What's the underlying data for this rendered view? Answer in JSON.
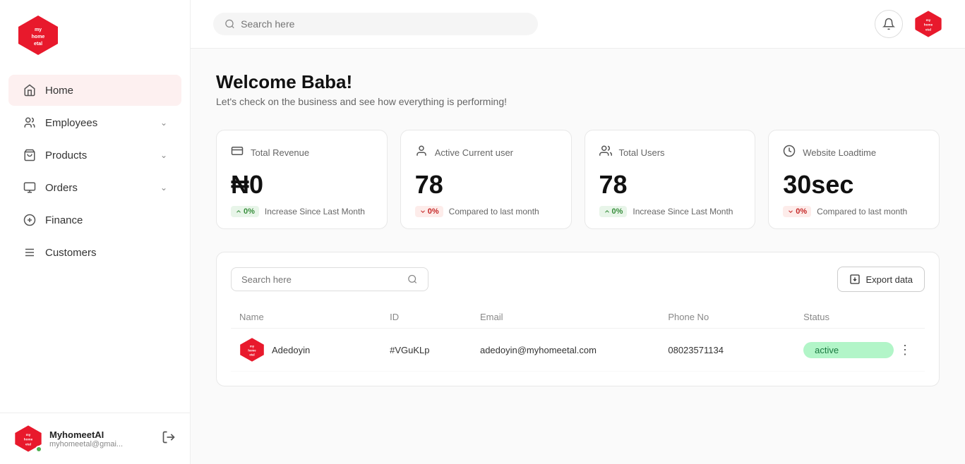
{
  "sidebar": {
    "nav_items": [
      {
        "id": "home",
        "label": "Home",
        "icon": "home",
        "active": true,
        "has_chevron": false
      },
      {
        "id": "employees",
        "label": "Employees",
        "icon": "employees",
        "active": false,
        "has_chevron": true
      },
      {
        "id": "products",
        "label": "Products",
        "icon": "products",
        "active": false,
        "has_chevron": true
      },
      {
        "id": "orders",
        "label": "Orders",
        "icon": "orders",
        "active": false,
        "has_chevron": true
      },
      {
        "id": "finance",
        "label": "Finance",
        "icon": "finance",
        "active": false,
        "has_chevron": false
      },
      {
        "id": "customers",
        "label": "Customers",
        "icon": "customers",
        "active": false,
        "has_chevron": false
      }
    ],
    "user": {
      "name": "MyhomeetAI",
      "email": "myhomeetal@gmai...",
      "status": "online"
    }
  },
  "topbar": {
    "search_placeholder": "Search here"
  },
  "welcome": {
    "title": "Welcome Baba!",
    "subtitle": "Let's check on the business and see how everything is performing!"
  },
  "stat_cards": [
    {
      "id": "total-revenue",
      "icon": "revenue-icon",
      "label": "Total Revenue",
      "value": "₦0",
      "badge_type": "green",
      "badge_value": "0%",
      "badge_text": "Increase Since Last Month"
    },
    {
      "id": "active-users",
      "icon": "user-icon",
      "label": "Active Current user",
      "value": "78",
      "badge_type": "red",
      "badge_value": "0%",
      "badge_text": "Compared to last month"
    },
    {
      "id": "total-users",
      "icon": "users-icon",
      "label": "Total Users",
      "value": "78",
      "badge_type": "green",
      "badge_value": "0%",
      "badge_text": "Increase Since Last Month"
    },
    {
      "id": "website-loadtime",
      "icon": "clock-icon",
      "label": "Website Loadtime",
      "value": "30sec",
      "badge_type": "red",
      "badge_value": "0%",
      "badge_text": "Compared to last month"
    }
  ],
  "table": {
    "search_placeholder": "Search here",
    "export_label": "Export data",
    "columns": [
      "Name",
      "ID",
      "Email",
      "Phone No",
      "Status",
      ""
    ],
    "rows": [
      {
        "name": "Adedoyin",
        "id": "#VGuKLp",
        "email": "adedoyin@myhomeetal.com",
        "phone": "08023571134",
        "status": "active"
      }
    ]
  }
}
